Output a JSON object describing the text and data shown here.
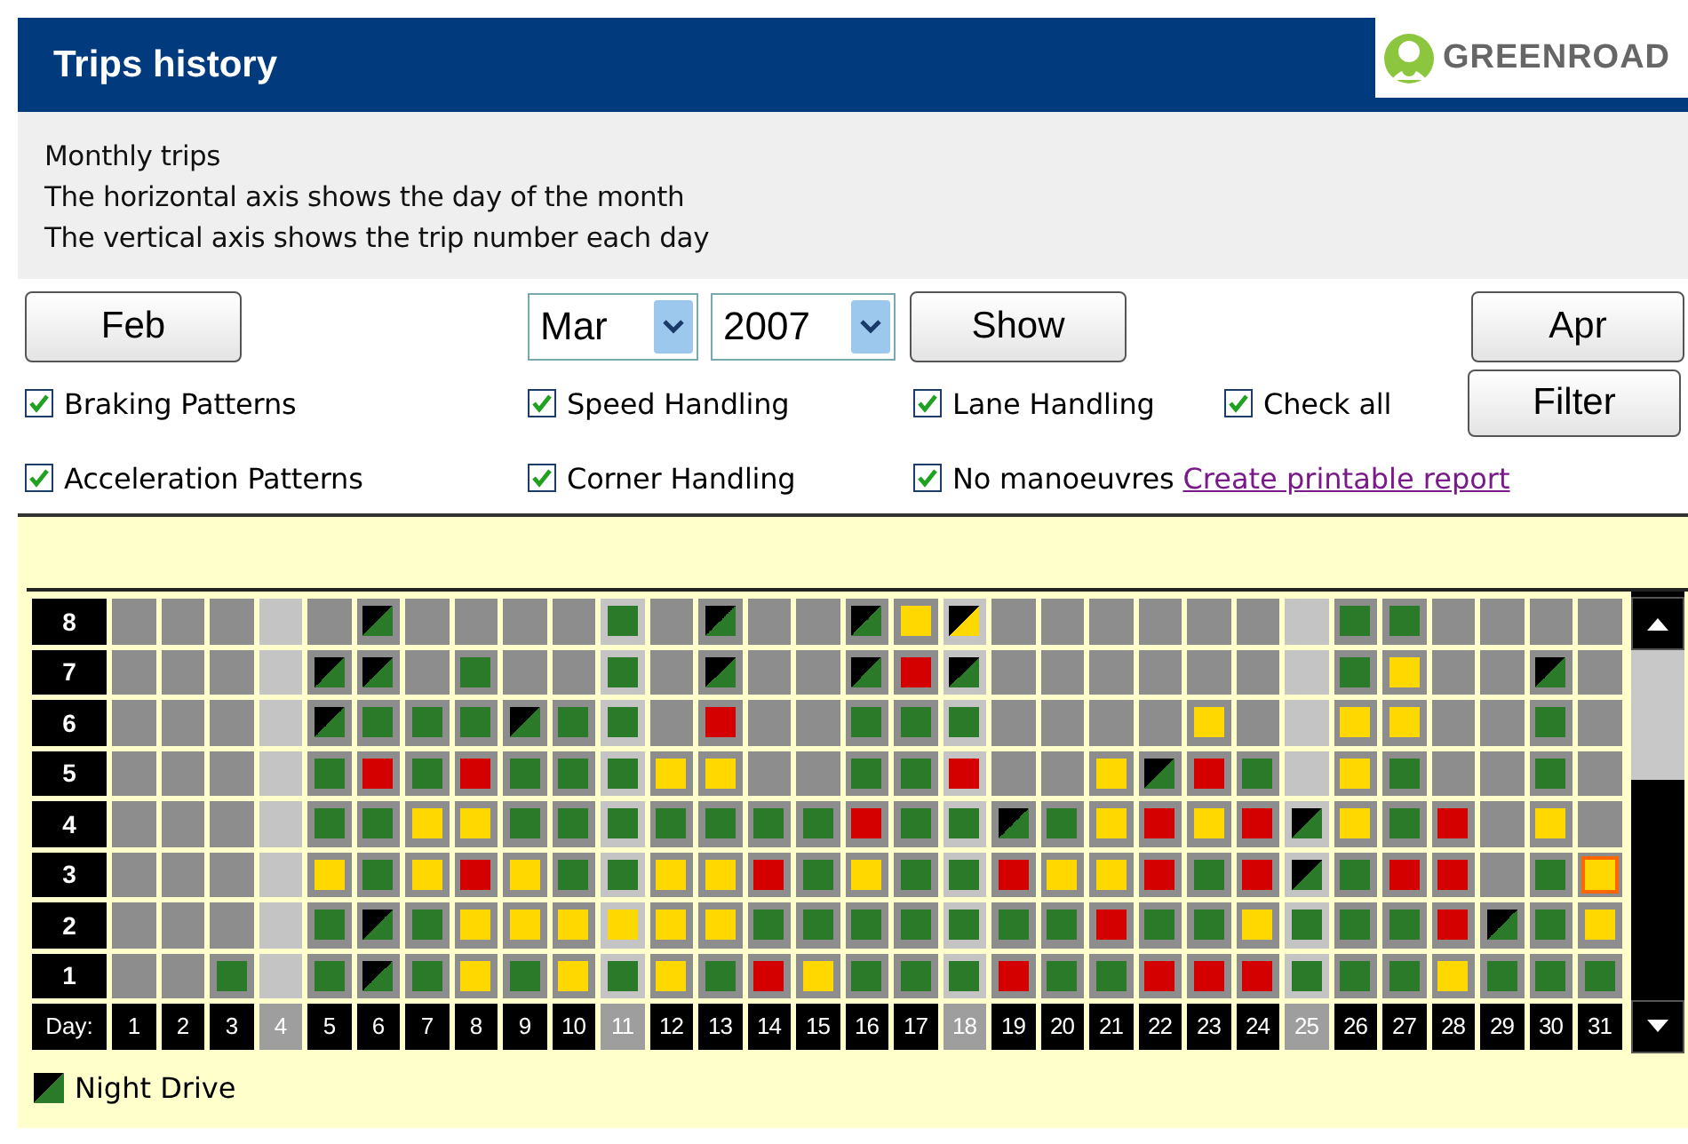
{
  "header": {
    "title": "Trips history",
    "logo_text": "GREENROAD"
  },
  "info": [
    "Monthly trips",
    "The horizontal axis shows the day of the month",
    "The vertical axis shows the trip number each day"
  ],
  "nav": {
    "previous": "Feb",
    "month": "Mar",
    "year": "2007",
    "show": "Show",
    "next": "Apr",
    "filter": "Filter"
  },
  "filters": [
    {
      "label": "Braking Patterns",
      "checked": true
    },
    {
      "label": "Speed Handling",
      "checked": true
    },
    {
      "label": "Lane Handling",
      "checked": true
    },
    {
      "label": "Check all",
      "checked": true
    },
    {
      "label": "Acceleration Patterns",
      "checked": true
    },
    {
      "label": "Corner Handling",
      "checked": true
    },
    {
      "label": "No manoeuvres",
      "checked": true
    }
  ],
  "report_link": "Create printable report",
  "grid": {
    "trip_labels": [
      "8",
      "7",
      "6",
      "5",
      "4",
      "3",
      "2",
      "1"
    ],
    "day_label": "Day:",
    "days": [
      {
        "label": "1",
        "dimmed": false,
        "trips": [
          {
            "kind": "none",
            "selected": false
          },
          {
            "kind": "none",
            "selected": false
          },
          {
            "kind": "none",
            "selected": false
          },
          {
            "kind": "none",
            "selected": false
          },
          {
            "kind": "none",
            "selected": false
          },
          {
            "kind": "none",
            "selected": false
          },
          {
            "kind": "none",
            "selected": false
          },
          {
            "kind": "none",
            "selected": false
          }
        ]
      },
      {
        "label": "2",
        "dimmed": false,
        "trips": [
          {
            "kind": "none",
            "selected": false
          },
          {
            "kind": "none",
            "selected": false
          },
          {
            "kind": "none",
            "selected": false
          },
          {
            "kind": "none",
            "selected": false
          },
          {
            "kind": "none",
            "selected": false
          },
          {
            "kind": "none",
            "selected": false
          },
          {
            "kind": "none",
            "selected": false
          },
          {
            "kind": "none",
            "selected": false
          }
        ]
      },
      {
        "label": "3",
        "dimmed": false,
        "trips": [
          {
            "kind": "green",
            "selected": false
          },
          {
            "kind": "none",
            "selected": false
          },
          {
            "kind": "none",
            "selected": false
          },
          {
            "kind": "none",
            "selected": false
          },
          {
            "kind": "none",
            "selected": false
          },
          {
            "kind": "none",
            "selected": false
          },
          {
            "kind": "none",
            "selected": false
          },
          {
            "kind": "none",
            "selected": false
          }
        ]
      },
      {
        "label": "4",
        "dimmed": true,
        "trips": [
          {
            "kind": "none",
            "selected": false
          },
          {
            "kind": "none",
            "selected": false
          },
          {
            "kind": "none",
            "selected": false
          },
          {
            "kind": "none",
            "selected": false
          },
          {
            "kind": "none",
            "selected": false
          },
          {
            "kind": "none",
            "selected": false
          },
          {
            "kind": "none",
            "selected": false
          },
          {
            "kind": "none",
            "selected": false
          }
        ]
      },
      {
        "label": "5",
        "dimmed": false,
        "trips": [
          {
            "kind": "green",
            "selected": false
          },
          {
            "kind": "green",
            "selected": false
          },
          {
            "kind": "yellow",
            "selected": false
          },
          {
            "kind": "green",
            "selected": false
          },
          {
            "kind": "green",
            "selected": false
          },
          {
            "kind": "night",
            "selected": false
          },
          {
            "kind": "night",
            "selected": false
          },
          {
            "kind": "none",
            "selected": false
          }
        ]
      },
      {
        "label": "6",
        "dimmed": false,
        "trips": [
          {
            "kind": "night",
            "selected": false
          },
          {
            "kind": "night",
            "selected": false
          },
          {
            "kind": "green",
            "selected": false
          },
          {
            "kind": "green",
            "selected": false
          },
          {
            "kind": "red",
            "selected": false
          },
          {
            "kind": "green",
            "selected": false
          },
          {
            "kind": "night",
            "selected": false
          },
          {
            "kind": "night",
            "selected": false
          }
        ]
      },
      {
        "label": "7",
        "dimmed": false,
        "trips": [
          {
            "kind": "green",
            "selected": false
          },
          {
            "kind": "green",
            "selected": false
          },
          {
            "kind": "yellow",
            "selected": false
          },
          {
            "kind": "yellow",
            "selected": false
          },
          {
            "kind": "green",
            "selected": false
          },
          {
            "kind": "green",
            "selected": false
          },
          {
            "kind": "none",
            "selected": false
          },
          {
            "kind": "none",
            "selected": false
          }
        ]
      },
      {
        "label": "8",
        "dimmed": false,
        "trips": [
          {
            "kind": "yellow",
            "selected": false
          },
          {
            "kind": "yellow",
            "selected": false
          },
          {
            "kind": "red",
            "selected": false
          },
          {
            "kind": "yellow",
            "selected": false
          },
          {
            "kind": "red",
            "selected": false
          },
          {
            "kind": "green",
            "selected": false
          },
          {
            "kind": "green",
            "selected": false
          },
          {
            "kind": "none",
            "selected": false
          }
        ]
      },
      {
        "label": "9",
        "dimmed": false,
        "trips": [
          {
            "kind": "green",
            "selected": false
          },
          {
            "kind": "yellow",
            "selected": false
          },
          {
            "kind": "yellow",
            "selected": false
          },
          {
            "kind": "green",
            "selected": false
          },
          {
            "kind": "green",
            "selected": false
          },
          {
            "kind": "night",
            "selected": false
          },
          {
            "kind": "none",
            "selected": false
          },
          {
            "kind": "none",
            "selected": false
          }
        ]
      },
      {
        "label": "10",
        "dimmed": false,
        "trips": [
          {
            "kind": "yellow",
            "selected": false
          },
          {
            "kind": "yellow",
            "selected": false
          },
          {
            "kind": "green",
            "selected": false
          },
          {
            "kind": "green",
            "selected": false
          },
          {
            "kind": "green",
            "selected": false
          },
          {
            "kind": "green",
            "selected": false
          },
          {
            "kind": "none",
            "selected": false
          },
          {
            "kind": "none",
            "selected": false
          }
        ]
      },
      {
        "label": "11",
        "dimmed": true,
        "trips": [
          {
            "kind": "green",
            "selected": false
          },
          {
            "kind": "yellow",
            "selected": false
          },
          {
            "kind": "green",
            "selected": false
          },
          {
            "kind": "green",
            "selected": false
          },
          {
            "kind": "green",
            "selected": false
          },
          {
            "kind": "green",
            "selected": false
          },
          {
            "kind": "green",
            "selected": false
          },
          {
            "kind": "green",
            "selected": false
          }
        ]
      },
      {
        "label": "12",
        "dimmed": false,
        "trips": [
          {
            "kind": "yellow",
            "selected": false
          },
          {
            "kind": "yellow",
            "selected": false
          },
          {
            "kind": "yellow",
            "selected": false
          },
          {
            "kind": "green",
            "selected": false
          },
          {
            "kind": "yellow",
            "selected": false
          },
          {
            "kind": "none",
            "selected": false
          },
          {
            "kind": "none",
            "selected": false
          },
          {
            "kind": "none",
            "selected": false
          }
        ]
      },
      {
        "label": "13",
        "dimmed": false,
        "trips": [
          {
            "kind": "green",
            "selected": false
          },
          {
            "kind": "yellow",
            "selected": false
          },
          {
            "kind": "yellow",
            "selected": false
          },
          {
            "kind": "green",
            "selected": false
          },
          {
            "kind": "yellow",
            "selected": false
          },
          {
            "kind": "red",
            "selected": false
          },
          {
            "kind": "night",
            "selected": false
          },
          {
            "kind": "night",
            "selected": false
          }
        ]
      },
      {
        "label": "14",
        "dimmed": false,
        "trips": [
          {
            "kind": "red",
            "selected": false
          },
          {
            "kind": "green",
            "selected": false
          },
          {
            "kind": "red",
            "selected": false
          },
          {
            "kind": "green",
            "selected": false
          },
          {
            "kind": "none",
            "selected": false
          },
          {
            "kind": "none",
            "selected": false
          },
          {
            "kind": "none",
            "selected": false
          },
          {
            "kind": "none",
            "selected": false
          }
        ]
      },
      {
        "label": "15",
        "dimmed": false,
        "trips": [
          {
            "kind": "yellow",
            "selected": false
          },
          {
            "kind": "green",
            "selected": false
          },
          {
            "kind": "green",
            "selected": false
          },
          {
            "kind": "green",
            "selected": false
          },
          {
            "kind": "none",
            "selected": false
          },
          {
            "kind": "none",
            "selected": false
          },
          {
            "kind": "none",
            "selected": false
          },
          {
            "kind": "none",
            "selected": false
          }
        ]
      },
      {
        "label": "16",
        "dimmed": false,
        "trips": [
          {
            "kind": "green",
            "selected": false
          },
          {
            "kind": "green",
            "selected": false
          },
          {
            "kind": "yellow",
            "selected": false
          },
          {
            "kind": "red",
            "selected": false
          },
          {
            "kind": "green",
            "selected": false
          },
          {
            "kind": "green",
            "selected": false
          },
          {
            "kind": "night",
            "selected": false
          },
          {
            "kind": "night",
            "selected": false
          }
        ]
      },
      {
        "label": "17",
        "dimmed": false,
        "trips": [
          {
            "kind": "green",
            "selected": false
          },
          {
            "kind": "green",
            "selected": false
          },
          {
            "kind": "green",
            "selected": false
          },
          {
            "kind": "green",
            "selected": false
          },
          {
            "kind": "green",
            "selected": false
          },
          {
            "kind": "green",
            "selected": false
          },
          {
            "kind": "red",
            "selected": false
          },
          {
            "kind": "yellow",
            "selected": false
          }
        ]
      },
      {
        "label": "18",
        "dimmed": true,
        "trips": [
          {
            "kind": "green",
            "selected": false
          },
          {
            "kind": "green",
            "selected": false
          },
          {
            "kind": "green",
            "selected": false
          },
          {
            "kind": "green",
            "selected": false
          },
          {
            "kind": "red",
            "selected": false
          },
          {
            "kind": "green",
            "selected": false
          },
          {
            "kind": "night",
            "selected": false
          },
          {
            "kind": "night-yellow",
            "selected": false
          }
        ]
      },
      {
        "label": "19",
        "dimmed": false,
        "trips": [
          {
            "kind": "red",
            "selected": false
          },
          {
            "kind": "green",
            "selected": false
          },
          {
            "kind": "red",
            "selected": false
          },
          {
            "kind": "night",
            "selected": false
          },
          {
            "kind": "none",
            "selected": false
          },
          {
            "kind": "none",
            "selected": false
          },
          {
            "kind": "none",
            "selected": false
          },
          {
            "kind": "none",
            "selected": false
          }
        ]
      },
      {
        "label": "20",
        "dimmed": false,
        "trips": [
          {
            "kind": "green",
            "selected": false
          },
          {
            "kind": "green",
            "selected": false
          },
          {
            "kind": "yellow",
            "selected": false
          },
          {
            "kind": "green",
            "selected": false
          },
          {
            "kind": "none",
            "selected": false
          },
          {
            "kind": "none",
            "selected": false
          },
          {
            "kind": "none",
            "selected": false
          },
          {
            "kind": "none",
            "selected": false
          }
        ]
      },
      {
        "label": "21",
        "dimmed": false,
        "trips": [
          {
            "kind": "green",
            "selected": false
          },
          {
            "kind": "red",
            "selected": false
          },
          {
            "kind": "yellow",
            "selected": false
          },
          {
            "kind": "yellow",
            "selected": false
          },
          {
            "kind": "yellow",
            "selected": false
          },
          {
            "kind": "none",
            "selected": false
          },
          {
            "kind": "none",
            "selected": false
          },
          {
            "kind": "none",
            "selected": false
          }
        ]
      },
      {
        "label": "22",
        "dimmed": false,
        "trips": [
          {
            "kind": "red",
            "selected": false
          },
          {
            "kind": "green",
            "selected": false
          },
          {
            "kind": "red",
            "selected": false
          },
          {
            "kind": "red",
            "selected": false
          },
          {
            "kind": "night",
            "selected": false
          },
          {
            "kind": "none",
            "selected": false
          },
          {
            "kind": "none",
            "selected": false
          },
          {
            "kind": "none",
            "selected": false
          }
        ]
      },
      {
        "label": "23",
        "dimmed": false,
        "trips": [
          {
            "kind": "red",
            "selected": false
          },
          {
            "kind": "green",
            "selected": false
          },
          {
            "kind": "green",
            "selected": false
          },
          {
            "kind": "yellow",
            "selected": false
          },
          {
            "kind": "red",
            "selected": false
          },
          {
            "kind": "yellow",
            "selected": false
          },
          {
            "kind": "none",
            "selected": false
          },
          {
            "kind": "none",
            "selected": false
          }
        ]
      },
      {
        "label": "24",
        "dimmed": false,
        "trips": [
          {
            "kind": "red",
            "selected": false
          },
          {
            "kind": "yellow",
            "selected": false
          },
          {
            "kind": "red",
            "selected": false
          },
          {
            "kind": "red",
            "selected": false
          },
          {
            "kind": "green",
            "selected": false
          },
          {
            "kind": "none",
            "selected": false
          },
          {
            "kind": "none",
            "selected": false
          },
          {
            "kind": "none",
            "selected": false
          }
        ]
      },
      {
        "label": "25",
        "dimmed": true,
        "trips": [
          {
            "kind": "green",
            "selected": false
          },
          {
            "kind": "green",
            "selected": false
          },
          {
            "kind": "night",
            "selected": false
          },
          {
            "kind": "night",
            "selected": false
          },
          {
            "kind": "none",
            "selected": false
          },
          {
            "kind": "none",
            "selected": false
          },
          {
            "kind": "none",
            "selected": false
          },
          {
            "kind": "none",
            "selected": false
          }
        ]
      },
      {
        "label": "26",
        "dimmed": false,
        "trips": [
          {
            "kind": "green",
            "selected": false
          },
          {
            "kind": "green",
            "selected": false
          },
          {
            "kind": "green",
            "selected": false
          },
          {
            "kind": "yellow",
            "selected": false
          },
          {
            "kind": "yellow",
            "selected": false
          },
          {
            "kind": "yellow",
            "selected": false
          },
          {
            "kind": "green",
            "selected": false
          },
          {
            "kind": "green",
            "selected": false
          }
        ]
      },
      {
        "label": "27",
        "dimmed": false,
        "trips": [
          {
            "kind": "green",
            "selected": false
          },
          {
            "kind": "green",
            "selected": false
          },
          {
            "kind": "red",
            "selected": false
          },
          {
            "kind": "green",
            "selected": false
          },
          {
            "kind": "green",
            "selected": false
          },
          {
            "kind": "yellow",
            "selected": false
          },
          {
            "kind": "yellow",
            "selected": false
          },
          {
            "kind": "green",
            "selected": false
          }
        ]
      },
      {
        "label": "28",
        "dimmed": false,
        "trips": [
          {
            "kind": "yellow",
            "selected": false
          },
          {
            "kind": "red",
            "selected": false
          },
          {
            "kind": "red",
            "selected": false
          },
          {
            "kind": "red",
            "selected": false
          },
          {
            "kind": "none",
            "selected": false
          },
          {
            "kind": "none",
            "selected": false
          },
          {
            "kind": "none",
            "selected": false
          },
          {
            "kind": "none",
            "selected": false
          }
        ]
      },
      {
        "label": "29",
        "dimmed": false,
        "trips": [
          {
            "kind": "green",
            "selected": false
          },
          {
            "kind": "night",
            "selected": false
          },
          {
            "kind": "none",
            "selected": false
          },
          {
            "kind": "none",
            "selected": false
          },
          {
            "kind": "none",
            "selected": false
          },
          {
            "kind": "none",
            "selected": false
          },
          {
            "kind": "none",
            "selected": false
          },
          {
            "kind": "none",
            "selected": false
          }
        ]
      },
      {
        "label": "30",
        "dimmed": false,
        "trips": [
          {
            "kind": "green",
            "selected": false
          },
          {
            "kind": "green",
            "selected": false
          },
          {
            "kind": "green",
            "selected": false
          },
          {
            "kind": "yellow",
            "selected": false
          },
          {
            "kind": "green",
            "selected": false
          },
          {
            "kind": "green",
            "selected": false
          },
          {
            "kind": "night",
            "selected": false
          },
          {
            "kind": "none",
            "selected": false
          }
        ]
      },
      {
        "label": "31",
        "dimmed": false,
        "trips": [
          {
            "kind": "green",
            "selected": false
          },
          {
            "kind": "yellow",
            "selected": false
          },
          {
            "kind": "yellow",
            "selected": true
          },
          {
            "kind": "none",
            "selected": false
          },
          {
            "kind": "none",
            "selected": false
          },
          {
            "kind": "none",
            "selected": false
          },
          {
            "kind": "none",
            "selected": false
          },
          {
            "kind": "none",
            "selected": false
          }
        ]
      }
    ]
  },
  "legend": [
    {
      "kind": "night",
      "label": "Night Drive"
    }
  ]
}
